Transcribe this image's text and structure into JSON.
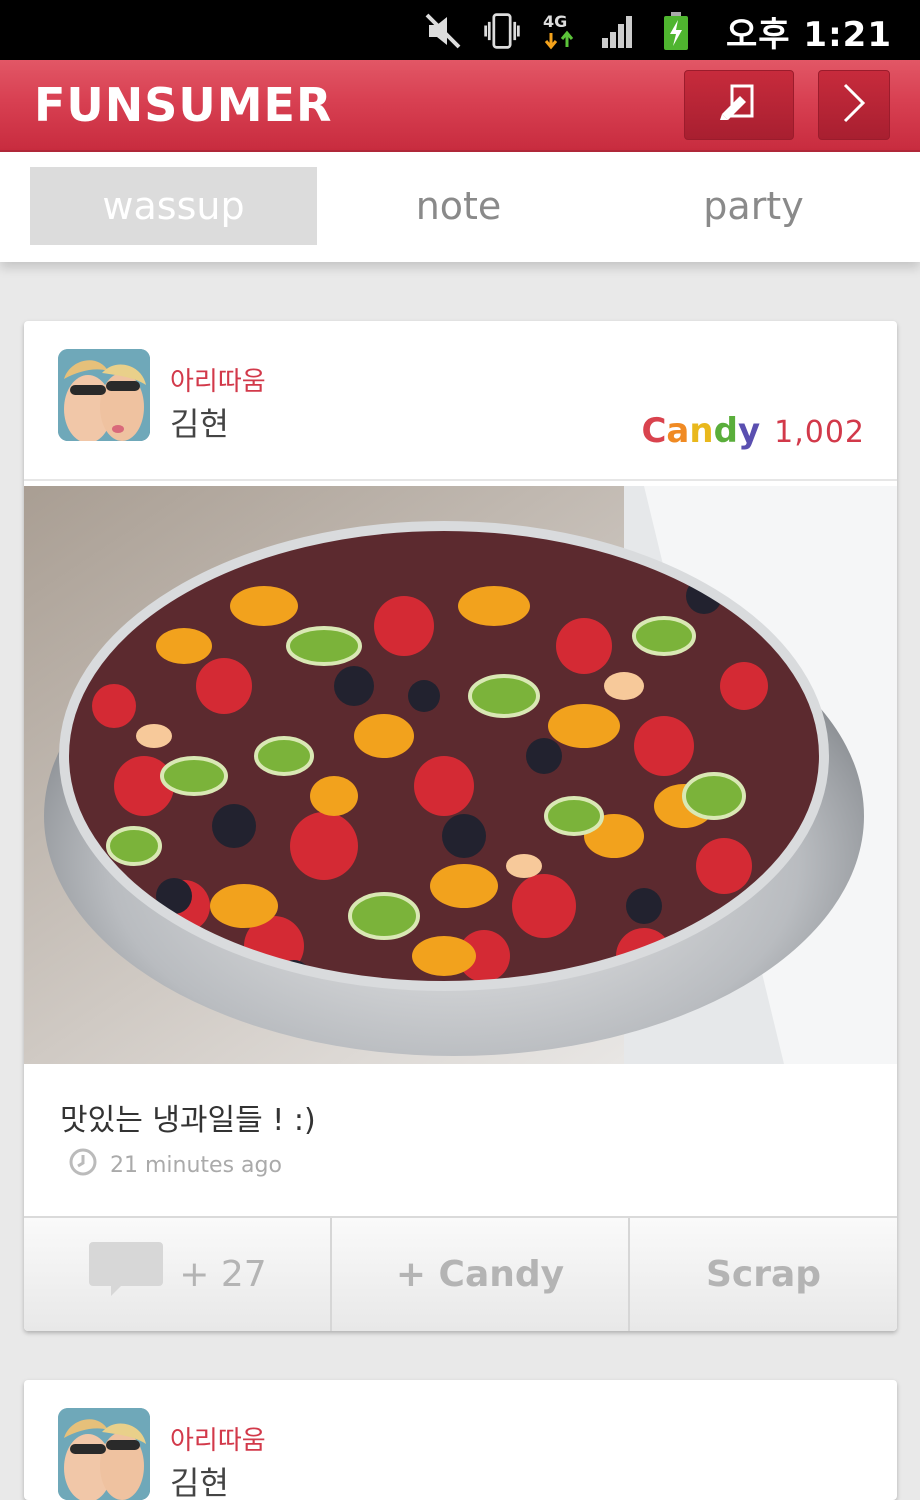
{
  "status_bar": {
    "time": "오후 1:21",
    "icons": [
      "mute-icon",
      "vibrate-icon",
      "4g-icon",
      "signal-icon",
      "battery-charging-icon"
    ]
  },
  "header": {
    "brand": "FUNSUMER",
    "write_icon": "write-icon",
    "next_icon": "chevron-right-icon",
    "accent_color": "#d84052"
  },
  "tabs": [
    {
      "label": "wassup",
      "active": true
    },
    {
      "label": "note",
      "active": false
    },
    {
      "label": "party",
      "active": false
    }
  ],
  "posts": [
    {
      "group": "아리따움",
      "user": "김현",
      "candy_label": "Candy",
      "candy_count": "1,002",
      "caption": "맛있는 냉과일들 ! :)",
      "time_ago": "21 minutes ago",
      "comment_count": "+ 27",
      "candy_action": "+ Candy",
      "scrap_action": "Scrap"
    },
    {
      "group": "아리따움",
      "user": "김현"
    }
  ]
}
